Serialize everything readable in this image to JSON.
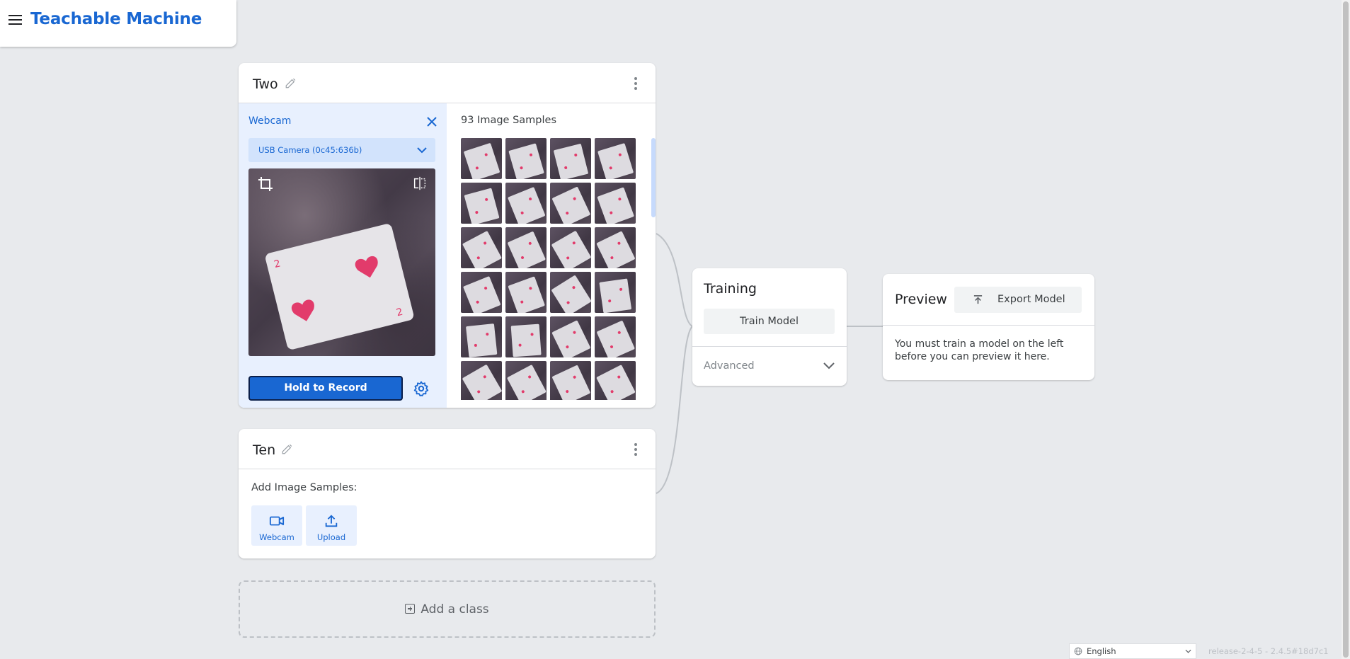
{
  "header": {
    "title": "Teachable Machine"
  },
  "classes": [
    {
      "name": "Two",
      "webcam": {
        "title": "Webcam",
        "camera": "USB Camera (0c45:636b)",
        "record_label": "Hold to Record"
      },
      "samples_title": "93 Image Samples"
    },
    {
      "name": "Ten",
      "add_samples_label": "Add Image Samples:",
      "webcam_label": "Webcam",
      "upload_label": "Upload"
    }
  ],
  "add_class_label": "Add a class",
  "training": {
    "title": "Training",
    "train_label": "Train Model",
    "advanced_label": "Advanced"
  },
  "preview": {
    "title": "Preview",
    "export_label": "Export Model",
    "message": "You must train a model on the left before you can preview it here."
  },
  "footer": {
    "language": "English",
    "version": "release-2-4-5 - 2.4.5#18d7c1"
  },
  "colors": {
    "accent": "#1967d2",
    "background": "#e8eaed",
    "webcam_panel": "#e8f0fe"
  },
  "icons": [
    "menu-icon",
    "pencil-icon",
    "more-vert-icon",
    "close-icon",
    "chevron-down-icon",
    "crop-icon",
    "flip-icon",
    "gear-icon",
    "webcam-icon",
    "upload-icon",
    "export-icon",
    "add-box-icon",
    "globe-icon"
  ]
}
